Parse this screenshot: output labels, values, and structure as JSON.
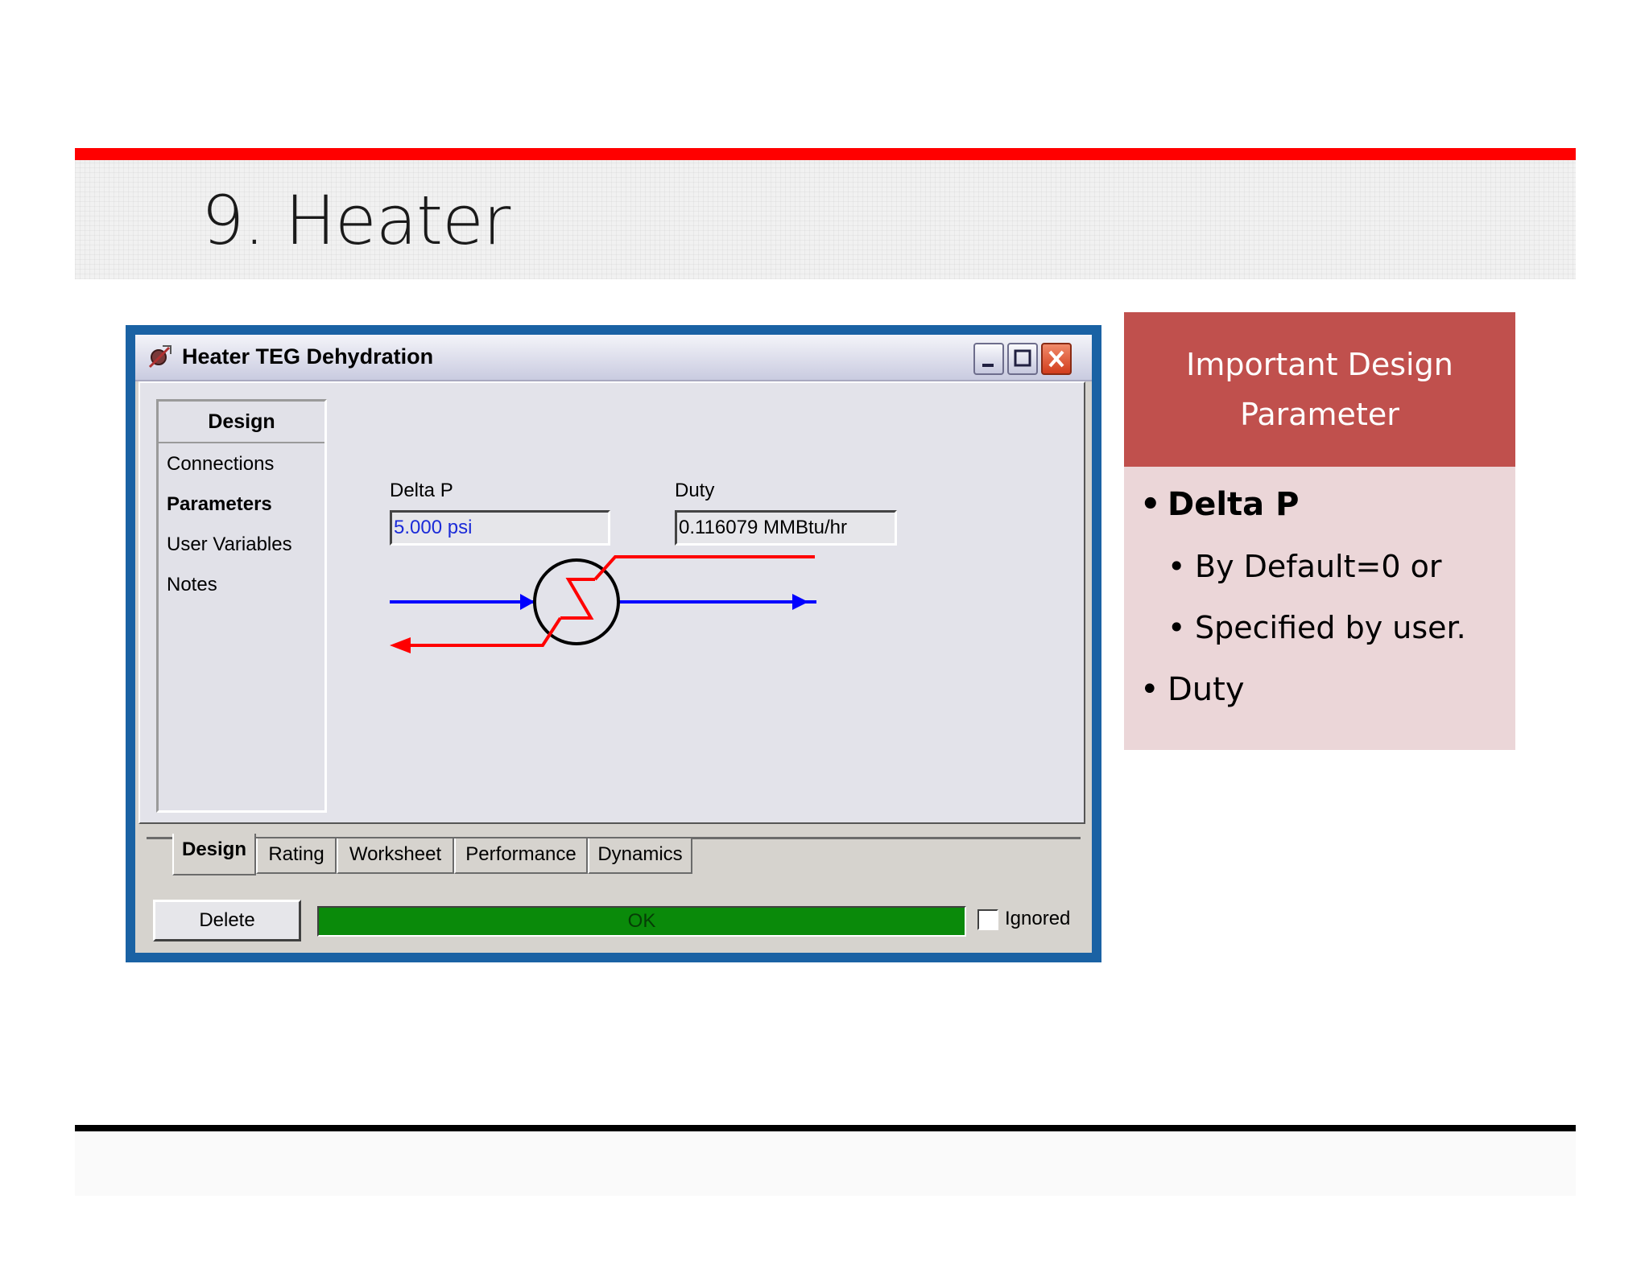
{
  "slide": {
    "title": "9. Heater",
    "accent_color": "#ff0000"
  },
  "dialog": {
    "window_title": "Heater TEG Dehydration",
    "window_buttons": [
      "minimize-icon",
      "maximize-icon",
      "close-icon"
    ],
    "nav": {
      "header": "Design",
      "items": [
        {
          "label": "Connections",
          "selected": false
        },
        {
          "label": "Parameters",
          "selected": true
        },
        {
          "label": "User Variables",
          "selected": false
        },
        {
          "label": "Notes",
          "selected": false
        }
      ]
    },
    "fields": {
      "delta_p": {
        "label": "Delta P",
        "value": "5.000 psi"
      },
      "duty": {
        "label": "Duty",
        "value": "0.116079 MMBtu/hr"
      }
    },
    "diagram": {
      "process_stream_color": "#0000ff",
      "energy_stream_color": "#ff0000"
    },
    "tabs": [
      {
        "label": "Design",
        "active": true
      },
      {
        "label": "Rating",
        "active": false
      },
      {
        "label": "Worksheet",
        "active": false
      },
      {
        "label": "Performance",
        "active": false
      },
      {
        "label": "Dynamics",
        "active": false
      }
    ],
    "footer": {
      "delete_label": "Delete",
      "status_text": "OK",
      "status_color": "#0a8a0a",
      "ignored_label": "Ignored",
      "ignored_checked": false
    }
  },
  "info_panel": {
    "header": [
      "Important Design",
      "Parameter"
    ],
    "header_color": "#c0504d",
    "bullets": [
      {
        "text": "Delta P",
        "level": 1,
        "bold": true
      },
      {
        "text": "By Default=0 or",
        "level": 2,
        "bold": false
      },
      {
        "text": "Specified by user.",
        "level": 2,
        "bold": false
      },
      {
        "text": "Duty",
        "level": 1,
        "bold": false
      }
    ]
  }
}
